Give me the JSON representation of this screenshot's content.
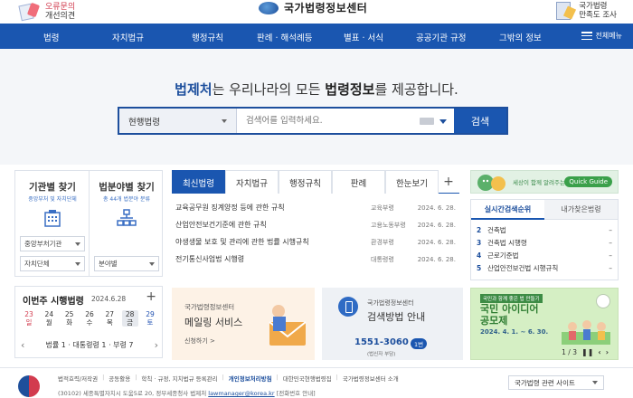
{
  "header": {
    "feedback_line1": "오류문의",
    "feedback_line2": "개선의견",
    "logo_text": "국가법령정보센터",
    "survey_line1": "국가법령",
    "survey_line2": "만족도 조사"
  },
  "nav": {
    "items": [
      "법령",
      "자치법규",
      "행정규칙",
      "판례 · 해석례등",
      "별표 · 서식",
      "공공기관 규정",
      "그밖의 정보"
    ],
    "all_menu": "전체메뉴"
  },
  "hero": {
    "title_part1": "법제처",
    "title_part2": "는 우리나라의 모든 ",
    "title_part3": "법령정보",
    "title_part4": "를 제공합니다.",
    "search_select": "현행법령",
    "search_placeholder": "검색어를 입력하세요.",
    "search_button": "검색"
  },
  "finder": {
    "agency": {
      "title": "기관별 찾기",
      "subtitle": "중앙부처 및 자치단체",
      "select1": "중앙부처기관",
      "select2": "자치단체"
    },
    "category": {
      "title": "법분야별 찾기",
      "subtitle": "총 44개 법분야 분류",
      "select1": "분야별"
    }
  },
  "weekly": {
    "title": "이번주 시행법령",
    "date": "2024.6.28",
    "days": [
      {
        "num": "23",
        "label": "일",
        "kind": "sun"
      },
      {
        "num": "24",
        "label": "월",
        "kind": "normal"
      },
      {
        "num": "25",
        "label": "화",
        "kind": "normal"
      },
      {
        "num": "26",
        "label": "수",
        "kind": "normal"
      },
      {
        "num": "27",
        "label": "목",
        "kind": "normal"
      },
      {
        "num": "28",
        "label": "금",
        "kind": "selected"
      },
      {
        "num": "29",
        "label": "토",
        "kind": "sat"
      }
    ],
    "counts": "법률 1 · 대통령령 1 · 부령 7"
  },
  "news": {
    "tabs": [
      "최신법령",
      "자치법규",
      "행정규칙",
      "판례",
      "한눈보기"
    ],
    "active_tab": 0,
    "rows": [
      {
        "title": "교육공무원 징계양정 등에 관한 규칙",
        "dept": "교육부령",
        "date": "2024. 6. 28."
      },
      {
        "title": "산업안전보건기준에 관한 규칙",
        "dept": "고용노동부령",
        "date": "2024. 6. 28."
      },
      {
        "title": "야생생물 보호 및 관리에 관한 법률 시행규칙",
        "dept": "환경부령",
        "date": "2024. 6. 28."
      },
      {
        "title": "전기통신사업법 시행령",
        "dept": "대통령령",
        "date": "2024. 6. 28."
      }
    ]
  },
  "quick_guide": {
    "text": "세상이 함께 알려주는 국법",
    "badge": "Quick Guide"
  },
  "ranking": {
    "tabs": [
      "실시간검색순위",
      "내가찾은법령"
    ],
    "items": [
      {
        "rank": "2",
        "label": "건축법",
        "mark": "–"
      },
      {
        "rank": "3",
        "label": "건축법 시행령",
        "mark": "–"
      },
      {
        "rank": "4",
        "label": "근로기준법",
        "mark": "–"
      },
      {
        "rank": "5",
        "label": "산업안전보건법 시행규칙",
        "mark": "–"
      }
    ]
  },
  "mail_card": {
    "line1": "국가법령정보센터",
    "line2": "메일링 서비스",
    "cta": "신청하기  >"
  },
  "guide_card": {
    "line1": "국가법령정보센터",
    "line2": "검색방법 안내",
    "phone": "1551-3060",
    "badge": "1번",
    "note": "(법신자 부담)"
  },
  "banner": {
    "tag": "국민과 함께 좋은 법 만들기",
    "title1": "국민 아이디어",
    "title2": "공모제",
    "date": "2024. 4. 1. ~ 6. 30.",
    "pager": "1 / 3"
  },
  "footer": {
    "links": [
      "법적효력/저작권",
      "공동활용",
      "학칙 · 규정, 지치법규 등록관리",
      "개인정보처리방침",
      "대한민국현행법령집",
      "국가법령정보센터 소개"
    ],
    "highlight_index": 3,
    "address_prefix": "(30102) 세종특별자치시 도움5로 20, 정부세종청사 법제처",
    "email": "lawmanager@korea.kr",
    "address_suffix": "[전화번호 안내]",
    "related_select": "국가법령 관련 사이트"
  }
}
